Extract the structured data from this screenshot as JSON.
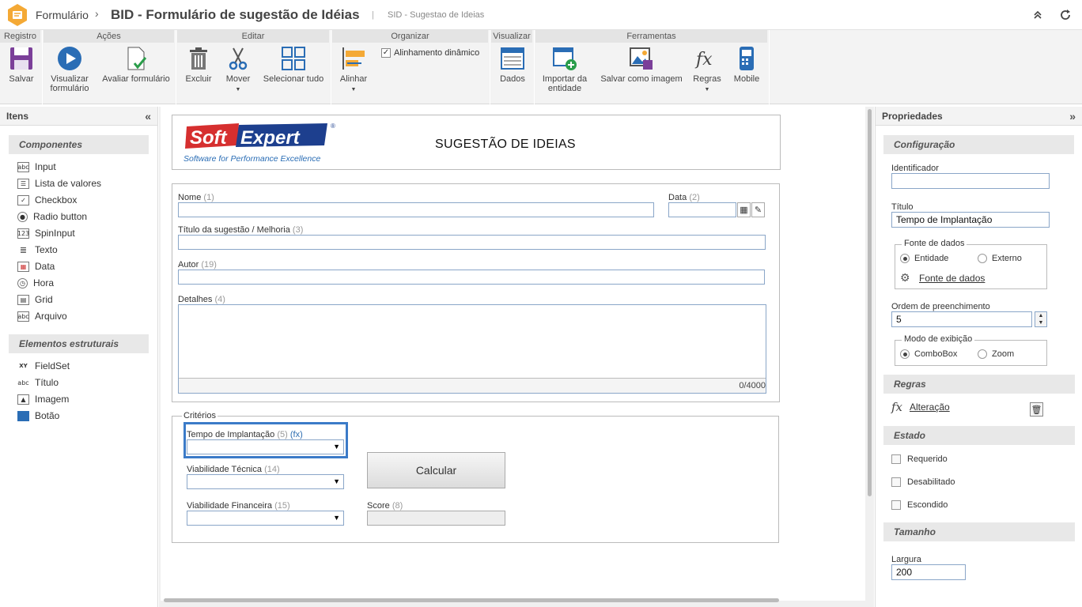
{
  "titlebar": {
    "breadcrumb": "Formulário",
    "title": "BID - Formulário de sugestão de Idéias",
    "separator": "|",
    "subtitle": "SID - Sugestao de Ideias"
  },
  "ribbon": {
    "groups": [
      "Registro",
      "Ações",
      "Editar",
      "Organizar",
      "Visualizar",
      "Ferramentas"
    ],
    "buttons": {
      "salvar": "Salvar",
      "visualizar_l1": "Visualizar",
      "visualizar_l2": "formulário",
      "avaliar": "Avaliar formulário",
      "excluir": "Excluir",
      "mover": "Mover",
      "selecionar": "Selecionar tudo",
      "alinhar": "Alinhar",
      "alinhamento": "Alinhamento dinâmico",
      "dados": "Dados",
      "importar_l1": "Importar da",
      "importar_l2": "entidade",
      "salvar_imagem": "Salvar como imagem",
      "regras": "Regras",
      "mobile": "Mobile"
    }
  },
  "left": {
    "title": "Itens",
    "components_title": "Componentes",
    "components": [
      "Input",
      "Lista de valores",
      "Checkbox",
      "Radio button",
      "SpinInput",
      "Texto",
      "Data",
      "Hora",
      "Grid",
      "Arquivo"
    ],
    "structural_title": "Elementos estruturais",
    "structural": [
      "FieldSet",
      "Título",
      "Imagem",
      "Botão"
    ]
  },
  "form": {
    "logo_soft": "Soft",
    "logo_expert": "Expert",
    "logo_tagline": "Software for Performance Excellence",
    "title": "SUGESTÃO DE IDEIAS",
    "nome": "Nome",
    "nome_n": "(1)",
    "data": "Data",
    "data_n": "(2)",
    "titulo": "Título da sugestão / Melhoria",
    "titulo_n": "(3)",
    "autor": "Autor",
    "autor_n": "(19)",
    "detalhes": "Detalhes",
    "detalhes_n": "(4)",
    "counter": "0/4000",
    "criterios": "Critérios",
    "tempo": "Tempo de Implantação",
    "tempo_n": "(5)",
    "tempo_fx": "(fx)",
    "viab_tec": "Viabilidade Técnica",
    "viab_tec_n": "(14)",
    "viab_fin": "Viabilidade Financeira",
    "viab_fin_n": "(15)",
    "calcular": "Calcular",
    "score": "Score",
    "score_n": "(8)"
  },
  "props": {
    "title": "Propriedades",
    "configuracao": "Configuração",
    "identificador_label": "Identificador",
    "identificador_value": "",
    "titulo_label": "Título",
    "titulo_value": "Tempo de Implantação",
    "fonte_dados": "Fonte de dados",
    "entidade": "Entidade",
    "externo": "Externo",
    "fonte_link": "Fonte de dados",
    "ordem_label": "Ordem de preenchimento",
    "ordem_value": "5",
    "modo": "Modo de exibição",
    "combobox": "ComboBox",
    "zoom": "Zoom",
    "regras": "Regras",
    "alteracao": "Alteração",
    "estado": "Estado",
    "requerido": "Requerido",
    "desabilitado": "Desabilitado",
    "escondido": "Escondido",
    "tamanho": "Tamanho",
    "largura_label": "Largura",
    "largura_value": "200"
  },
  "colors": {
    "accent": "#3b7bc8",
    "logo_orange": "#f4a935",
    "logo_red": "#d62f2f",
    "logo_blue": "#1d3f8e"
  }
}
